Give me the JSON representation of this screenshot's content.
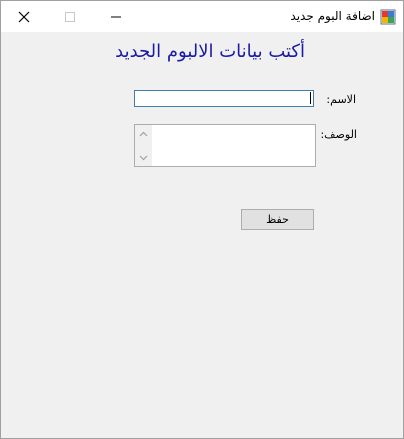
{
  "window": {
    "title": "اضافة البوم جديد",
    "icons": {
      "close": "close-icon",
      "maximize": "maximize-icon",
      "minimize": "minimize-icon",
      "app": "app-icon"
    }
  },
  "form": {
    "heading": "أكتب بيانات الالبوم الجديد",
    "name_label": "الاسم:",
    "name_value": "",
    "description_label": "الوصف:",
    "description_value": "",
    "save_label": "حفظ"
  },
  "colors": {
    "heading": "#1a1aa8",
    "input_focus_border": "#3c7fb1",
    "window_bg": "#f0f0f0"
  }
}
